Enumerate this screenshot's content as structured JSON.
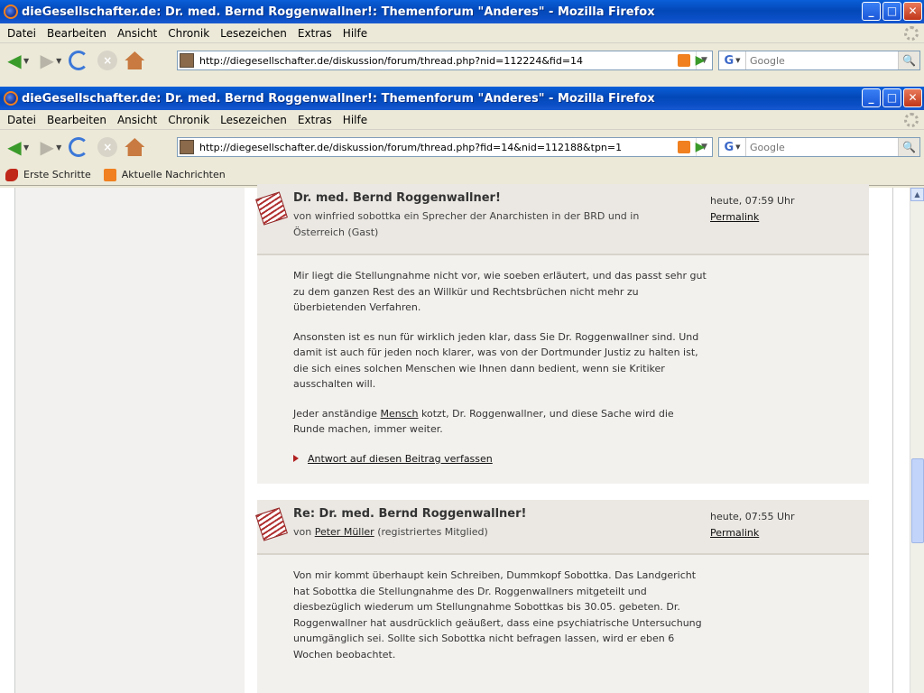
{
  "window_back": {
    "title": "dieGesellschafter.de: Dr. med. Bernd Roggenwallner!: Themenforum \"Anderes\" - Mozilla Firefox",
    "menu": [
      "Datei",
      "Bearbeiten",
      "Ansicht",
      "Chronik",
      "Lesezeichen",
      "Extras",
      "Hilfe"
    ],
    "url": "http://diegesellschafter.de/diskussion/forum/thread.php?nid=112224&fid=14",
    "search_placeholder": "Google"
  },
  "window": {
    "title": "dieGesellschafter.de: Dr. med. Bernd Roggenwallner!: Themenforum \"Anderes\" - Mozilla Firefox",
    "controls": {
      "minimize": "_",
      "maximize": "□",
      "close": "✕"
    },
    "menu": [
      "Datei",
      "Bearbeiten",
      "Ansicht",
      "Chronik",
      "Lesezeichen",
      "Extras",
      "Hilfe"
    ],
    "url": "http://diegesellschafter.de/diskussion/forum/thread.php?fid=14&nid=112188&tpn=1",
    "search_placeholder": "Google",
    "search_engine": "G",
    "bookmarks": [
      "Erste Schritte",
      "Aktuelle Nachrichten"
    ]
  },
  "posts": [
    {
      "title": "Dr. med. Bernd Roggenwallner!",
      "author_text": "von winfried sobottka ein Sprecher der Anarchisten in der BRD und in Österreich (Gast)",
      "time": "heute, 07:59 Uhr",
      "permalink": "Permalink",
      "paragraphs": [
        "Mir liegt die Stellungnahme nicht vor, wie soeben erläutert, und das passt sehr gut zu dem ganzen Rest des an Willkür und Rechtsbrüchen nicht mehr zu überbietenden Verfahren.",
        "Ansonsten ist es nun für wirklich jeden klar, dass Sie Dr. Roggenwallner sind. Und damit ist auch für jeden noch klarer, was von der Dortmunder Justiz zu halten ist, die sich eines solchen Menschen wie Ihnen dann bedient, wenn sie Kritiker ausschalten will."
      ],
      "p3_before": "Jeder anständige ",
      "p3_link": "Mensch",
      "p3_after": " kotzt, Dr. Roggenwallner, und diese Sache wird die Runde machen, immer weiter.",
      "reply": "Antwort auf diesen Beitrag verfassen"
    },
    {
      "title": "Re: Dr. med. Bernd Roggenwallner!",
      "author_prefix": "von ",
      "author_name": "Peter Müller",
      "author_suffix": " (registriertes Mitglied)",
      "time": "heute, 07:55 Uhr",
      "permalink": "Permalink",
      "paragraphs": [
        "Von mir kommt überhaupt kein Schreiben, Dummkopf Sobottka. Das Landgericht hat Sobottka die Stellungnahme des Dr. Roggenwallners mitgeteilt und diesbezüglich wiederum um Stellungnahme Sobottkas bis 30.05. gebeten. Dr. Roggenwallner hat ausdrücklich geäußert, dass eine psychiatrische Untersuchung unumgänglich sei. Sollte sich Sobottka nicht befragen lassen, wird er eben 6 Wochen beobachtet."
      ]
    }
  ]
}
